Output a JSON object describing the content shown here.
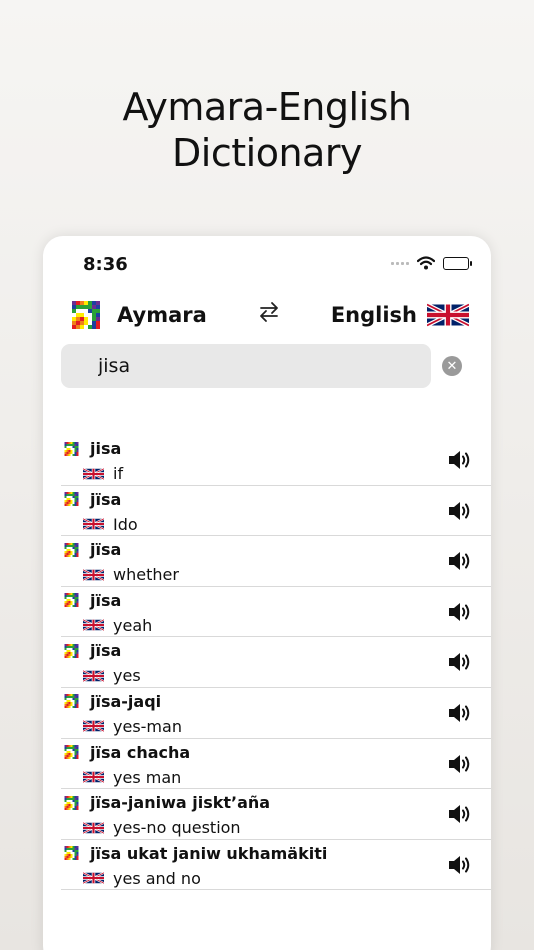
{
  "headline": {
    "line1": "Aymara-English",
    "line2": "Dictionary"
  },
  "status": {
    "time": "8:36",
    "icons": [
      "signal-dots-icon",
      "wifi-icon",
      "battery-icon"
    ]
  },
  "languages": {
    "source": "Aymara",
    "target": "English",
    "swap_icon": "swap-arrows-icon"
  },
  "search": {
    "value": "jisa",
    "placeholder": ""
  },
  "results": [
    {
      "word": "jisa",
      "translation": "if"
    },
    {
      "word": "jïsa",
      "translation": "Ido"
    },
    {
      "word": "jïsa",
      "translation": "whether"
    },
    {
      "word": "jïsa",
      "translation": "yeah"
    },
    {
      "word": "jïsa",
      "translation": "yes"
    },
    {
      "word": "jïsa-jaqi",
      "translation": "yes-man"
    },
    {
      "word": "jïsa chacha",
      "translation": "yes man"
    },
    {
      "word": "jïsa-janiwa jisktʼaña",
      "translation": "yes-no question"
    },
    {
      "word": "jïsa ukat janiw ukhamäkiti",
      "translation": "yes and no"
    }
  ],
  "colors": {
    "background": "#f0eeeb",
    "card": "#ffffff",
    "search_bg": "#e8e8e8",
    "clear": "#9a9a9a",
    "divider": "#d9d9d9"
  }
}
